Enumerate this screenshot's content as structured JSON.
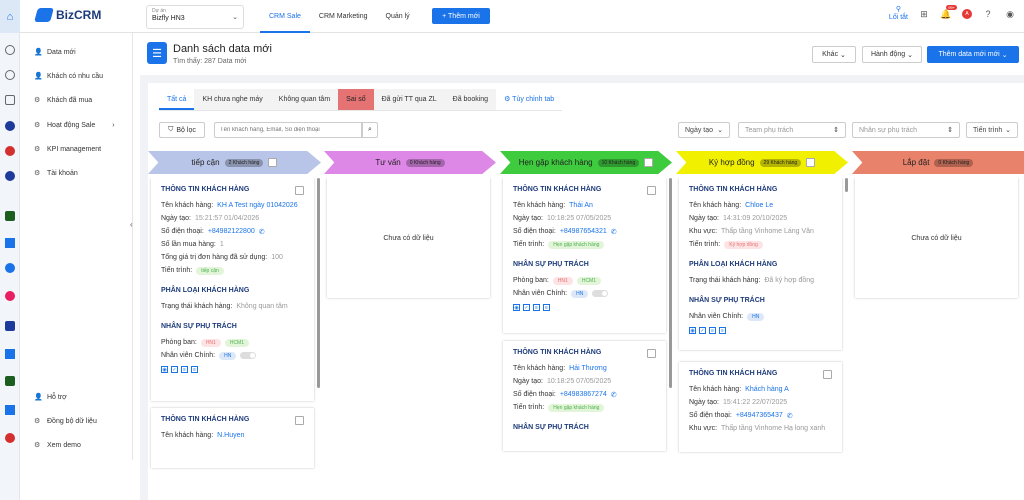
{
  "app": {
    "logo": "BizCRM"
  },
  "project": {
    "label": "Dự án",
    "value": "Bizfly HN3"
  },
  "nav": {
    "tabs": [
      "CRM Sale",
      "CRM Marketing",
      "Quản lý"
    ],
    "add_new": "+ Thêm mới"
  },
  "utils": {
    "filter_label": "Lối tắt",
    "notif_count": "99+",
    "avatar_letter": "A"
  },
  "sidebar": {
    "items": [
      "Data mới",
      "Khách có nhu cầu",
      "Khách đã mua",
      "Hoạt động Sale",
      "KPI management",
      "Tài khoản"
    ],
    "bottom": [
      "Hỗ trợ",
      "Đồng bộ dữ liệu",
      "Xem demo"
    ]
  },
  "header": {
    "title": "Danh sách data mới",
    "subtitle": "Tìm thấy: 287 Data mới",
    "btn_other": "Khác",
    "btn_action": "Hành động",
    "btn_add": "Thêm data mới mới"
  },
  "tabs": [
    "Tất cả",
    "KH chưa nghe máy",
    "Không quan tâm",
    "Sai số",
    "Đã gửi TT qua ZL",
    "Đã booking",
    "Tùy chỉnh tab"
  ],
  "filters": {
    "filter_btn": "Bộ lọc",
    "search_placeholder": "Tên khách hàng, Email, Số điện thoại",
    "date_select": "Ngày tạo",
    "team_select": "Team phụ trách",
    "staff_select": "Nhân sự phụ trách",
    "progress_select": "Tiến trình"
  },
  "stages": [
    {
      "name": "tiếp cận",
      "count": "2 Khách hàng",
      "color": "#b8c4e8"
    },
    {
      "name": "Tư vấn",
      "count": "0 Khách hàng",
      "color": "#dd87e6"
    },
    {
      "name": "Hẹn gặp khách hàng",
      "count": "10 Khách hàng",
      "color": "#3ecb3e"
    },
    {
      "name": "Ký hợp đồng",
      "count": "29 Khách hàng",
      "color": "#f0f000"
    },
    {
      "name": "Lắp đặt",
      "count": "0 Khách hàng",
      "color": "#e8826a"
    }
  ],
  "empty_text": "Chưa có dữ liệu",
  "labels": {
    "customer_info": "THÔNG TIN KHÁCH HÀNG",
    "customer_class": "PHÂN LOẠI KHÁCH HÀNG",
    "staff": "NHÂN SỰ PHỤ TRÁCH",
    "name": "Tên khách hàng:",
    "created": "Ngày tạo:",
    "phone": "Số điện thoại:",
    "buys": "Số lần mua hàng:",
    "total": "Tổng giá trị đơn hàng đã sử dụng:",
    "progress": "Tiến trình:",
    "status": "Trạng thái khách hàng:",
    "dept": "Phòng ban:",
    "main_staff": "Nhân viên Chính:",
    "area": "Khu vực:"
  },
  "col1": {
    "card1": {
      "name": "KH A Test ngày 01042026",
      "created": "15:21:57 01/04/2026",
      "phone": "+84982122800",
      "buys": "1",
      "total": "100",
      "progress": "tiếp cận",
      "status": "Không quan tâm",
      "dept": [
        "HN1",
        "HCM1"
      ],
      "staff": "HN"
    },
    "card2": {
      "name": "N.Huyen"
    }
  },
  "col3": {
    "card1": {
      "name": "Thái An",
      "created": "10:18:25 07/05/2025",
      "phone": "+84987654321",
      "progress": "Hẹn gặp khách hàng",
      "dept": [
        "HN1",
        "HCM1"
      ],
      "staff": "HN"
    },
    "card2": {
      "name": "Hải Thương",
      "created": "10:18:25 07/05/2025",
      "phone": "+84983867274",
      "progress": "Hẹn gặp khách hàng"
    }
  },
  "col4": {
    "card1": {
      "name": "Chloe Le",
      "created": "14:31:09 20/10/2025",
      "area": "Thấp tầng Vinhome Láng Văn",
      "progress": "Ký hợp đồng",
      "status": "Đã ký hợp đồng",
      "staff": "HN"
    },
    "card2": {
      "name": "Khách hàng A",
      "created": "15:41:22 22/07/2025",
      "phone": "+84947365437",
      "area": "Thấp tầng Vinhome Hạ long xanh"
    }
  }
}
